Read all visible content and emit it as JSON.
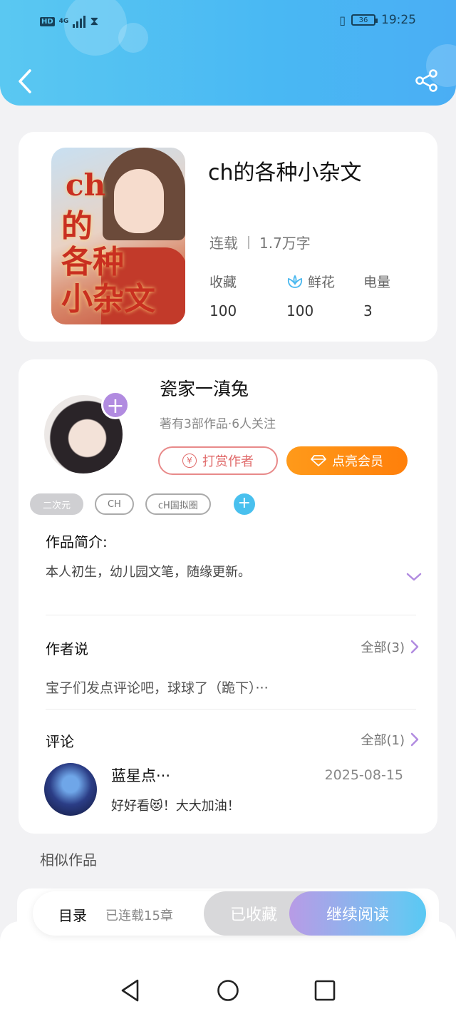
{
  "status_bar": {
    "network": "HD",
    "signal": "4G",
    "battery": "36",
    "time": "19:25"
  },
  "header": {
    "back_icon": "chevron-left-icon",
    "share_icon": "share-icon"
  },
  "book": {
    "cover_title_lines": [
      "ch",
      "的",
      "各种",
      "小杂文"
    ],
    "title": "ch的各种小杂文",
    "status": "连载",
    "word_count": "1.7万字",
    "stats": [
      {
        "label": "收藏",
        "value": "100",
        "icon": ""
      },
      {
        "label": "鲜花",
        "value": "100",
        "icon": "flower-icon"
      },
      {
        "label": "电量",
        "value": "3",
        "icon": ""
      }
    ]
  },
  "author": {
    "name": "瓷家一滇兔",
    "info": "著有3部作品·6人关注",
    "reward_label": "打赏作者",
    "vip_label": "点亮会员",
    "tags": [
      "二次元",
      "CH",
      "cH国拟圈"
    ]
  },
  "intro": {
    "title": "作品简介:",
    "text": "本人初生，幼儿园文笔，随缘更新。"
  },
  "author_say": {
    "title": "作者说",
    "all_label": "全部(3)",
    "text": "宝子们发点评论吧，球球了（跪下）···"
  },
  "comments": {
    "title": "评论",
    "all_label": "全部(1)",
    "items": [
      {
        "name": "蓝星点···",
        "date": "2025-08-15",
        "text": "好好看😻！大大加油！"
      }
    ]
  },
  "similar": {
    "title": "相似作品"
  },
  "bottom": {
    "toc_label": "目录",
    "toc_count": "已连载15章",
    "fav_label": "已收藏",
    "read_label": "继续阅读"
  },
  "colors": {
    "header": "#4ab8f3",
    "accent_purple": "#b18be0",
    "vip_orange": "#ff8a10",
    "reward_red": "#e06a6a",
    "tag_blue": "#49c0ee"
  }
}
